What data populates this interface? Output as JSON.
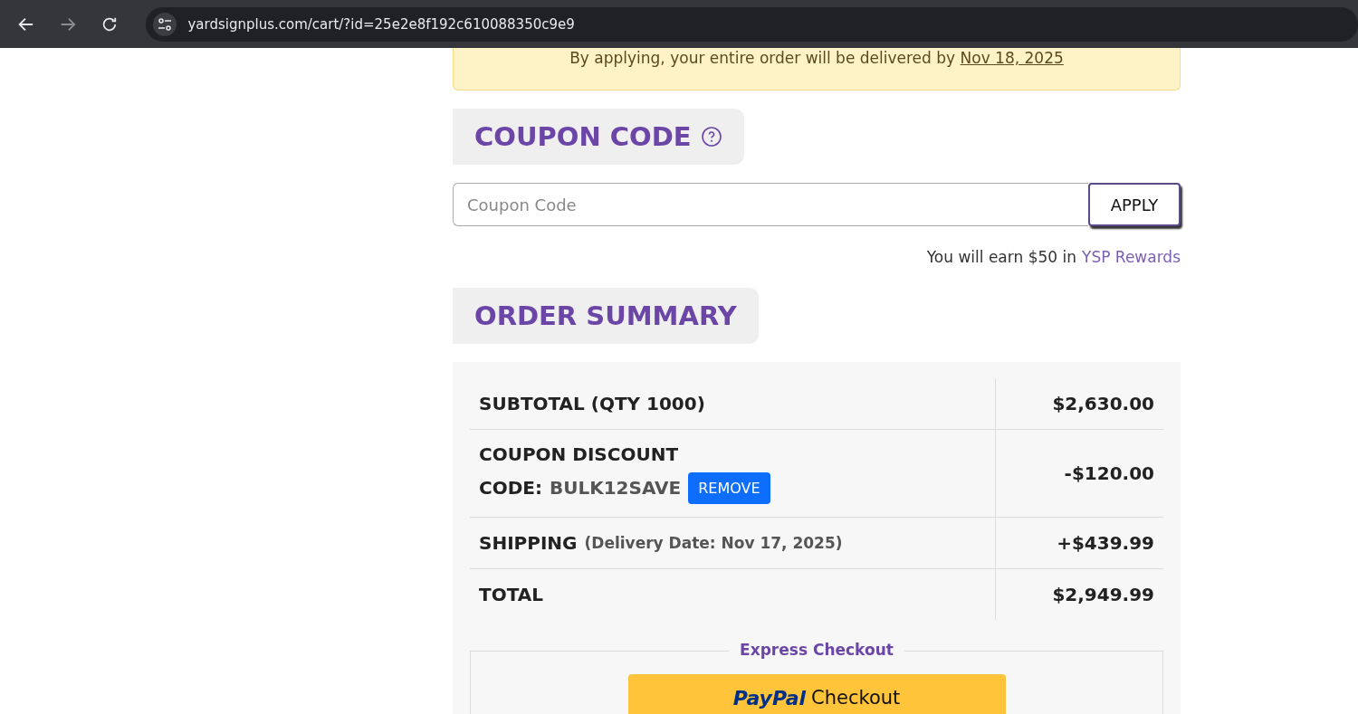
{
  "browser": {
    "url": "yardsignplus.com/cart/?id=25e2e8f192c610088350c9e9"
  },
  "delivery_notice": {
    "text": "By applying, your entire order will be delivered by",
    "date": "Nov 18, 2025"
  },
  "coupon": {
    "heading": "COUPON CODE",
    "placeholder": "Coupon Code",
    "button": "APPLY"
  },
  "rewards": {
    "text": "You will earn $50 in",
    "link": "YSP Rewards"
  },
  "summary": {
    "heading": "ORDER SUMMARY",
    "rows": [
      {
        "kind": "plain",
        "label": "SUBTOTAL (QTY 1000)",
        "value": "$2,630.00"
      },
      {
        "kind": "coupon",
        "label": "COUPON DISCOUNT",
        "code_label": "CODE:",
        "code": "BULK12SAVE",
        "button": "REMOVE",
        "value": "-$120.00"
      },
      {
        "kind": "shipping",
        "label": "SHIPPING",
        "note": "(Delivery Date: Nov 17, 2025)",
        "value": "+$439.99"
      },
      {
        "kind": "plain",
        "label": "TOTAL",
        "value": "$2,949.99"
      }
    ]
  },
  "express": {
    "title": "Express Checkout",
    "button_brand": "PayPal",
    "button_text": "Checkout"
  }
}
